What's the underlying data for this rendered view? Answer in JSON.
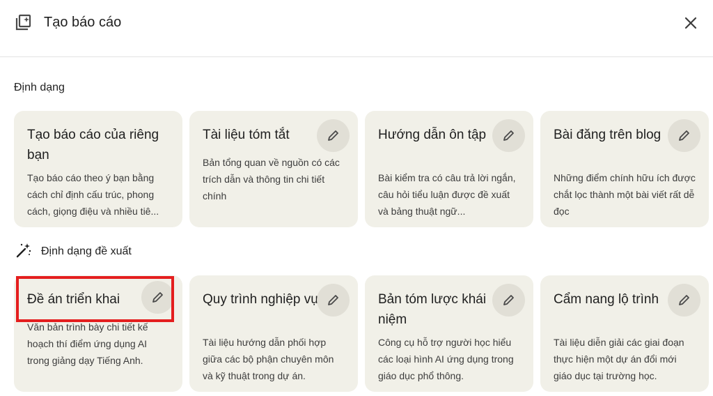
{
  "dialog": {
    "title": "Tạo báo cáo",
    "title_icon": "report-sparkle-icon",
    "close_icon": "close-icon"
  },
  "formats": {
    "heading": "Định dạng",
    "cards": [
      {
        "title": "Tạo báo cáo của riêng bạn",
        "description": "Tạo báo cáo theo ý bạn bằng cách chỉ định cấu trúc, phong cách, giọng điệu và nhiều tiê..."
      },
      {
        "title": "Tài liệu tóm tắt",
        "description": "Bản tổng quan về nguồn có các trích dẫn và thông tin chi tiết chính",
        "icon": "pencil-icon"
      },
      {
        "title": "Hướng dẫn ôn tập",
        "description": "Bài kiểm tra có câu trả lời ngắn, câu hỏi tiểu luận được đề xuất và bảng thuật ngữ...",
        "icon": "pencil-icon"
      },
      {
        "title": "Bài đăng trên blog",
        "description": "Những điểm chính hữu ích được chắt lọc thành một bài viết rất dễ đọc",
        "icon": "pencil-icon"
      }
    ]
  },
  "suggested": {
    "heading": "Định dạng đề xuất",
    "heading_icon": "magic-wand-icon",
    "cards": [
      {
        "title": "Đề án triển khai",
        "description": "Văn bản trình bày chi tiết kế hoạch thí điểm ứng dụng AI trong giảng dạy Tiếng Anh.",
        "icon": "pencil-icon"
      },
      {
        "title": "Quy trình nghiệp vụ",
        "description": "Tài liệu hướng dẫn phối hợp giữa các bộ phận chuyên môn và kỹ thuật trong dự án.",
        "icon": "pencil-icon"
      },
      {
        "title": "Bản tóm lược khái niệm",
        "description": "Công cụ hỗ trợ người học hiểu các loại hình AI ứng dụng trong giáo dục phổ thông.",
        "icon": "pencil-icon"
      },
      {
        "title": "Cẩm nang lộ trình",
        "description": "Tài liệu diễn giải các giai đoạn thực hiện một dự án đổi mới giáo dục tại trường học.",
        "icon": "pencil-icon"
      }
    ]
  },
  "colors": {
    "card_bg": "#f1f0e8",
    "edit_button_bg": "#e1dfd6",
    "highlight": "#e41e1e"
  }
}
